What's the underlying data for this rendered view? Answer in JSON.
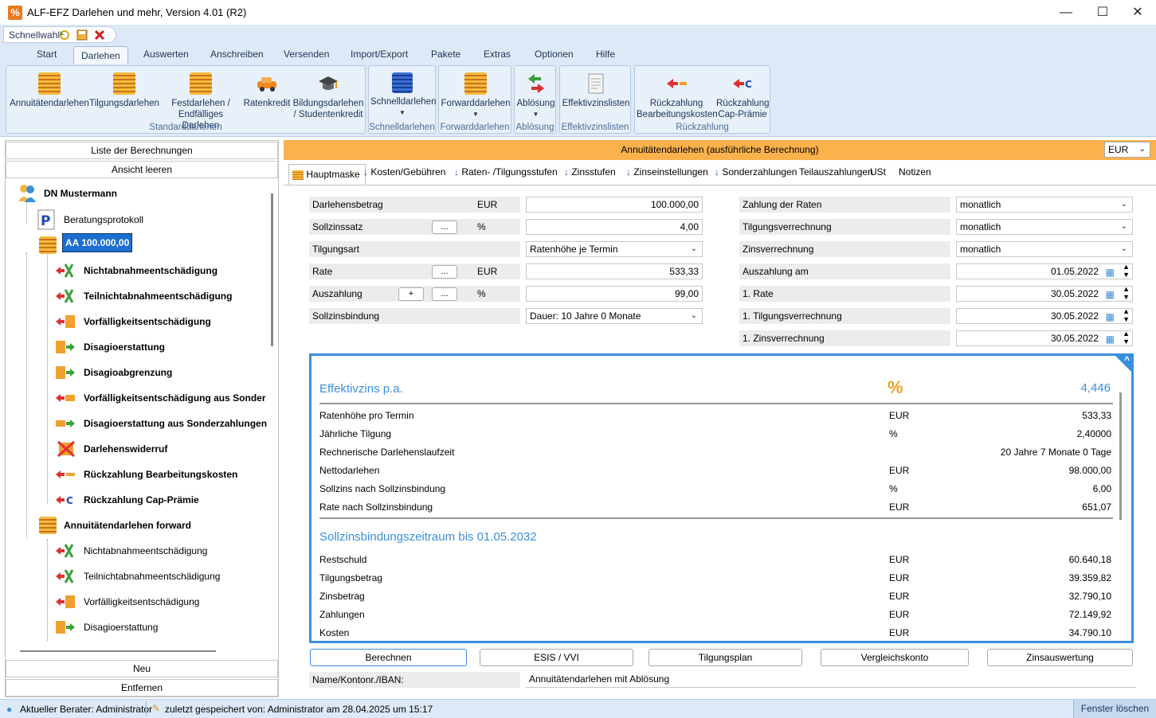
{
  "window": {
    "title": "ALF-EFZ Darlehen und mehr, Version 4.01 (R2)",
    "minimize": "—",
    "maximize": "☐",
    "close": "✕"
  },
  "quickbar": {
    "label": "Schnellwahl"
  },
  "tabs": [
    "Start",
    "Darlehen",
    "Auswerten",
    "Anschreiben",
    "Versenden",
    "Import/Export",
    "Pakete",
    "Extras",
    "Optionen",
    "Hilfe"
  ],
  "ribbon": {
    "annuitaet": "Annuitätendarlehen",
    "tilgung": "Tilgungsdarlehen",
    "fest1": "Festdarlehen /",
    "fest2": "Endfälliges Darlehen",
    "raten": "Ratenkredit",
    "bildung1": "Bildungsdarlehen",
    "bildung2": "/ Studentenkredit",
    "g_standard": "Standarddarlehen",
    "schnell": "Schnelldarlehen",
    "g_schnell": "Schnelldarlehen",
    "forward": "Forwarddarlehen",
    "g_forward": "Forwarddarlehen",
    "abloesung": "Ablösung",
    "g_abloesung": "Ablösung",
    "effektiv": "Effektivzinslisten",
    "g_effektiv": "Effektivzinslisten",
    "rueck1a": "Rückzahlung",
    "rueck1b": "Bearbeitungskosten",
    "rueck2a": "Rückzahlung",
    "rueck2b": "Cap-Prämie",
    "g_rueck": "Rückzahlung"
  },
  "left": {
    "liste": "Liste der Berechnungen",
    "ansicht": "Ansicht leeren",
    "neu": "Neu",
    "entfernen": "Entfernen",
    "tree": {
      "root": "DN Mustermann",
      "protokoll": "Beratungsprotokoll",
      "aa": "AA 100.000,00",
      "c1": "Nichtabnahmeentschädigung",
      "c2": "Teilnichtabnahmeentschädigung",
      "c3": "Vorfälligkeitsentschädigung",
      "c4": "Disagioerstattung",
      "c5": "Disagioabgrenzung",
      "c6": "Vorfälligkeitsentschädigung aus Sonderz",
      "c7": "Disagioerstattung aus Sonderzahlungen",
      "c8": "Darlehenswiderruf",
      "c9": "Rückzahlung Bearbeitungskosten",
      "c10": "Rückzahlung Cap-Prämie",
      "fwd": "Annuitätendarlehen forward",
      "f1": "Nichtabnahmeentschädigung",
      "f2": "Teilnichtabnahmeentschädigung",
      "f3": "Vorfälligkeitsentschädigung",
      "f4": "Disagioerstattung"
    }
  },
  "main": {
    "header": "Annuitätendarlehen (ausführliche Berechnung)",
    "currency": "EUR",
    "tabs": {
      "t1": "Hauptmaske",
      "t2": "Kosten/Gebühren",
      "t3": "Raten- /Tilgungsstufen",
      "t4": "Zinsstufen",
      "t5": "Zinseinstellungen",
      "t6": "Sonderzahlungen",
      "t7": "Teilauszahlungen",
      "t8": "USt",
      "t9": "Notizen"
    },
    "form": {
      "l1": "Darlehensbetrag",
      "u1": "EUR",
      "v1": "100.000,00",
      "l2": "Sollzinssatz",
      "u2": "%",
      "v2": "4,00",
      "l3": "Tilgungsart",
      "v3": "Ratenhöhe je Termin",
      "l4": "Rate",
      "u4": "EUR",
      "v4": "533,33",
      "l5": "Auszahlung",
      "u5": "%",
      "v5": "99,00",
      "plus": "+",
      "dots": "...",
      "l6": "Sollzinsbindung",
      "v6": "Dauer: 10 Jahre 0 Monate",
      "r1": "Zahlung der Raten",
      "rv1": "monatlich",
      "r2": "Tilgungsverrechnung",
      "rv2": "monatlich",
      "r3": "Zinsverrechnung",
      "rv3": "monatlich",
      "r4": "Auszahlung am",
      "rv4": "01.05.2022",
      "r5": "1. Rate",
      "rv5": "30.05.2022",
      "r6": "1. Tilgungsverrechnung",
      "rv6": "30.05.2022",
      "r7": "1. Zinsverrechnung",
      "rv7": "30.05.2022"
    },
    "summary": {
      "eff_label": "Effektivzins p.a.",
      "eff_sym": "%",
      "eff_val": "4,446",
      "rows1": [
        [
          "Ratenhöhe pro Termin",
          "EUR",
          "533,33"
        ],
        [
          "Jährliche Tilgung",
          "%",
          "2,40000"
        ],
        [
          "Rechnerische Darlehenslaufzeit",
          "",
          "20 Jahre 7 Monate 0 Tage"
        ],
        [
          "Nettodarlehen",
          "EUR",
          "98.000,00"
        ],
        [
          "Sollzins nach Sollzinsbindung",
          "%",
          "6,00"
        ],
        [
          "Rate nach Sollzinsbindung",
          "EUR",
          "651,07"
        ]
      ],
      "head2": "Sollzinsbindungszeitraum bis 01.05.2032",
      "rows2": [
        [
          "Restschuld",
          "EUR",
          "60.640,18"
        ],
        [
          "Tilgungsbetrag",
          "EUR",
          "39.359,82"
        ],
        [
          "Zinsbetrag",
          "EUR",
          "32.790,10"
        ],
        [
          "Zahlungen",
          "EUR",
          "72.149,92"
        ],
        [
          "Kosten",
          "EUR",
          "34.790.10"
        ]
      ]
    },
    "buttons": {
      "b1": "Berechnen",
      "b2": "ESIS / VVI",
      "b3": "Tilgungsplan",
      "b4": "Vergleichskonto",
      "b5": "Zinsauswertung"
    },
    "iban_label": "Name/Kontonr./IBAN:",
    "iban_value": "Annuitätendarlehen mit Ablösung"
  },
  "status": {
    "berater": "Aktueller Berater: Administrator",
    "saved": "zuletzt gespeichert von: Administrator am 28.04.2025 um 15:17",
    "clear": "Fenster löschen"
  }
}
